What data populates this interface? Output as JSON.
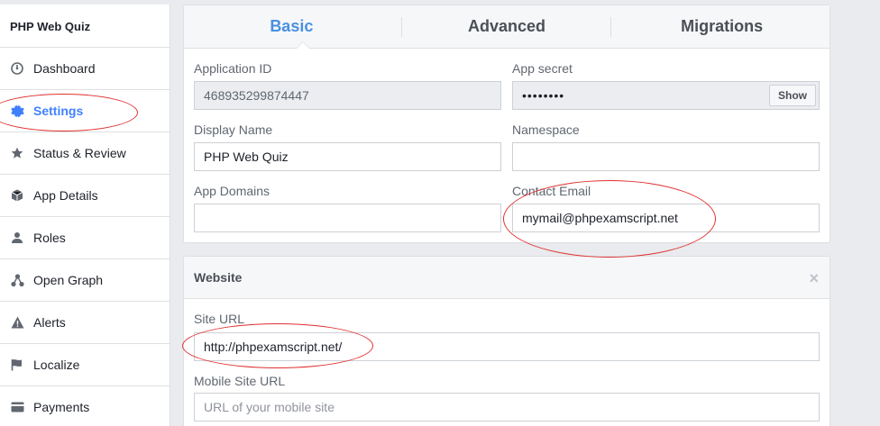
{
  "sidebar": {
    "app_name": "PHP Web Quiz",
    "items": [
      {
        "label": "Dashboard",
        "icon": "dashboard-icon"
      },
      {
        "label": "Settings",
        "icon": "gear-icon",
        "active": true
      },
      {
        "label": "Status & Review",
        "icon": "star-icon"
      },
      {
        "label": "App Details",
        "icon": "cube-icon"
      },
      {
        "label": "Roles",
        "icon": "person-icon"
      },
      {
        "label": "Open Graph",
        "icon": "graph-icon"
      },
      {
        "label": "Alerts",
        "icon": "warning-icon"
      },
      {
        "label": "Localize",
        "icon": "flag-icon"
      },
      {
        "label": "Payments",
        "icon": "credit-card-icon"
      }
    ]
  },
  "tabs": [
    "Basic",
    "Advanced",
    "Migrations"
  ],
  "basic": {
    "app_id_label": "Application ID",
    "app_id_value": "468935299874447",
    "app_secret_label": "App secret",
    "app_secret_mask": "••••••••",
    "show_label": "Show",
    "display_name_label": "Display Name",
    "display_name_value": "PHP Web Quiz",
    "namespace_label": "Namespace",
    "namespace_value": "",
    "app_domains_label": "App Domains",
    "app_domains_value": "",
    "contact_email_label": "Contact Email",
    "contact_email_value": "mymail@phpexamscript.net"
  },
  "website": {
    "title": "Website",
    "close": "×",
    "site_url_label": "Site URL",
    "site_url_value": "http://phpexamscript.net/",
    "mobile_url_label": "Mobile Site URL",
    "mobile_url_placeholder": "URL of your mobile site"
  },
  "colors": {
    "accent": "#4a90e2",
    "annotation": "#e03030"
  }
}
